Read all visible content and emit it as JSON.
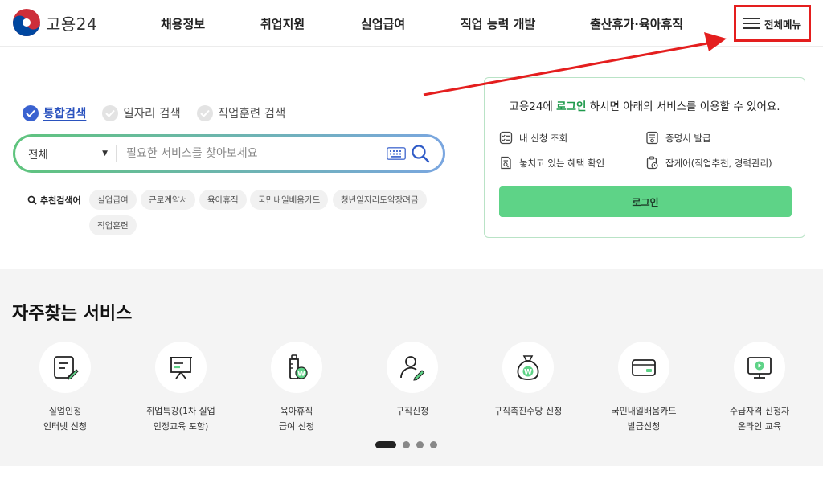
{
  "header": {
    "logo_text": "고용24",
    "nav": [
      "채용정보",
      "취업지원",
      "실업급여",
      "직업 능력 개발",
      "출산휴가·육아휴직"
    ],
    "menu_label": "전체메뉴"
  },
  "search": {
    "tabs": [
      {
        "label": "통합검색",
        "active": true
      },
      {
        "label": "일자리 검색",
        "active": false
      },
      {
        "label": "직업훈련 검색",
        "active": false
      }
    ],
    "scope": "전체",
    "placeholder": "필요한 서비스를 찾아보세요",
    "recommend_label": "추천검색어",
    "keywords": [
      "실업급여",
      "근로계약서",
      "육아휴직",
      "국민내일배움카드",
      "청년일자리도약장려금",
      "직업훈련"
    ]
  },
  "login_card": {
    "title_pre": "고용24에 ",
    "title_em": "로그인",
    "title_post": " 하시면 아래의 서비스를 이용할 수 있어요.",
    "links": [
      "내 신청 조회",
      "증명서 발급",
      "놓치고 있는 혜택 확인",
      "잡케어(직업추천, 경력관리)"
    ],
    "button": "로그인"
  },
  "frequent": {
    "title": "자주찾는 서비스",
    "services": [
      {
        "label": "실업인정\n인터넷 신청",
        "icon": "document-pen-icon"
      },
      {
        "label": "취업특강(1차 실업\n인정교육 포함)",
        "icon": "presentation-board-icon"
      },
      {
        "label": "육아휴직\n급여 신청",
        "icon": "baby-bottle-won-icon"
      },
      {
        "label": "구직신청",
        "icon": "person-pen-icon"
      },
      {
        "label": "구직촉진수당 신청",
        "icon": "money-bag-won-icon"
      },
      {
        "label": "국민내일배움카드\n발급신청",
        "icon": "credit-card-icon"
      },
      {
        "label": "수급자격 신청자\n온라인 교육",
        "icon": "monitor-play-icon"
      }
    ],
    "page_count": 4,
    "active_page": 1
  },
  "colors": {
    "accent_green": "#5ed387",
    "highlight_red": "#e41e1e",
    "tab_blue": "#2a52be"
  }
}
